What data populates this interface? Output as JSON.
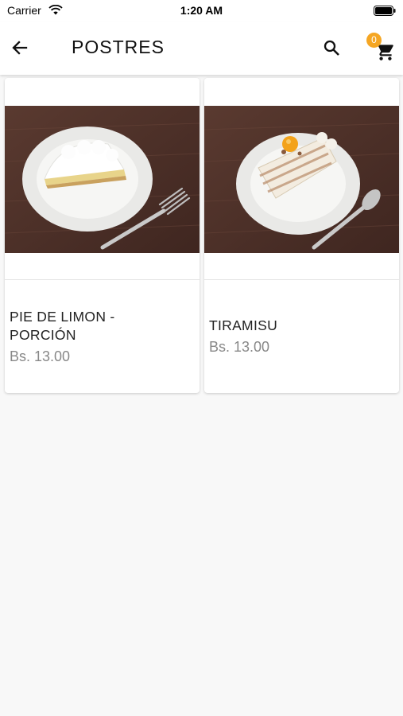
{
  "status": {
    "carrier": "Carrier",
    "time": "1:20 AM"
  },
  "appbar": {
    "title": "POSTRES",
    "cart_count": "0"
  },
  "products": [
    {
      "name": "PIE DE LIMON -\nPORCIÓN",
      "price": "Bs. 13.00"
    },
    {
      "name": "TIRAMISU",
      "price": "Bs. 13.00"
    }
  ],
  "colors": {
    "accent": "#f5a623",
    "background": "#f8f8f8",
    "card": "#ffffff",
    "price": "#888888"
  }
}
